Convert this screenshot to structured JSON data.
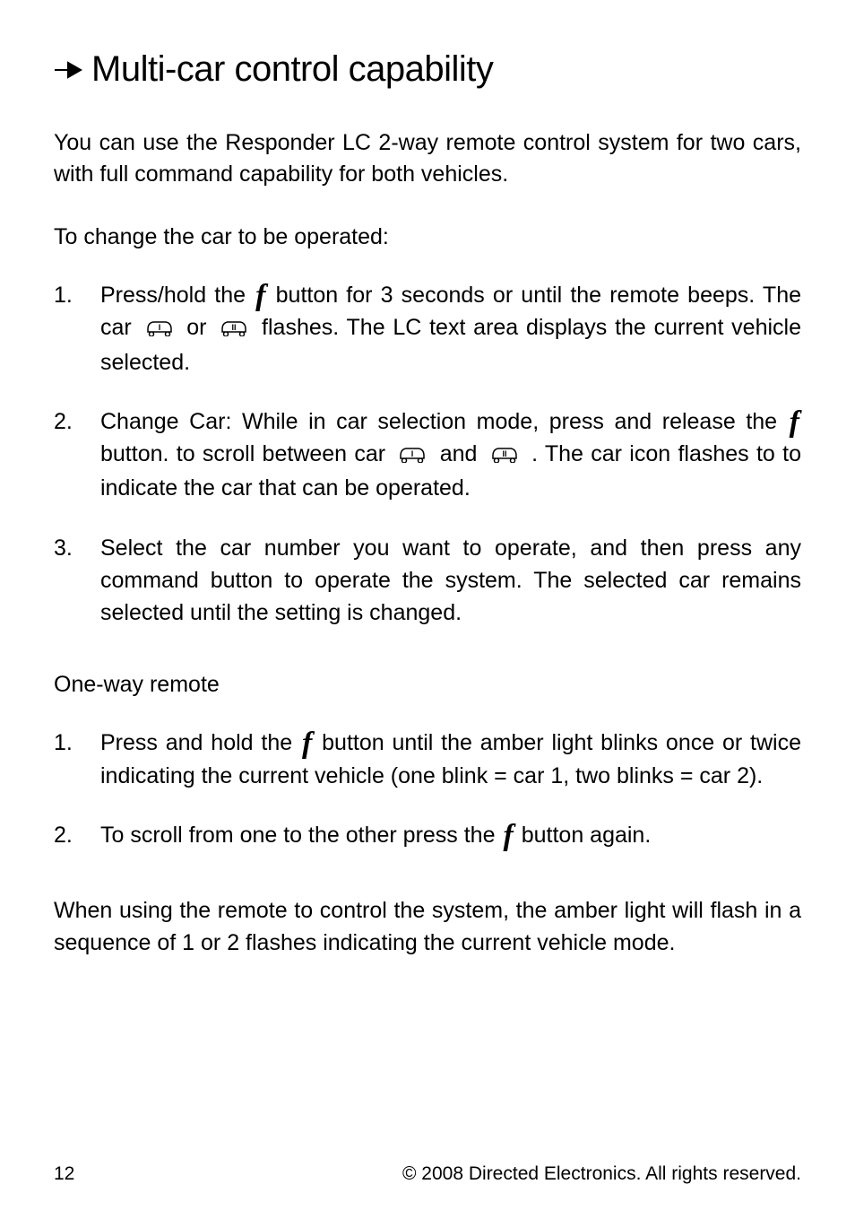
{
  "title": "Multi-car control capability",
  "intro": "You can use the Responder LC 2-way remote control system for two cars, with full command capability for both vehicles.",
  "sub1": "To change the car to be operated:",
  "list1": {
    "i1": {
      "num": "1.",
      "a": "Press/hold the ",
      "b": " button for 3 seconds or until the remote beeps. The car ",
      "c": " or ",
      "d": " flashes. The LC text area displays the current vehicle selected."
    },
    "i2": {
      "num": "2.",
      "a": "Change Car: While in car selection mode, press and release the ",
      "b": " button. to scroll between  car  ",
      "c": " and ",
      "d": " . The car icon flashes to to indicate the car that can be operated."
    },
    "i3": {
      "num": "3.",
      "a": "Select the car number you want to operate, and then press any command button to operate the system. The selected car remains selected until the setting is changed."
    }
  },
  "sub2": "One-way remote",
  "list2": {
    "i1": {
      "num": "1.",
      "a": "Press and hold the ",
      "b": " button until the amber light blinks once or twice indicating the current vehicle (one blink = car 1, two blinks = car 2)."
    },
    "i2": {
      "num": "2.",
      "a": "To scroll from one to the other press the ",
      "b": " button again."
    }
  },
  "closing": "When using the remote to control the system, the amber light will flash in a sequence of 1 or 2 flashes indicating the current vehicle mode.",
  "footer": {
    "page": "12",
    "copyright": "© 2008 Directed Electronics. All rights reserved."
  },
  "icons": {
    "f": "f",
    "car1_label": "I",
    "car2_label": "II"
  }
}
